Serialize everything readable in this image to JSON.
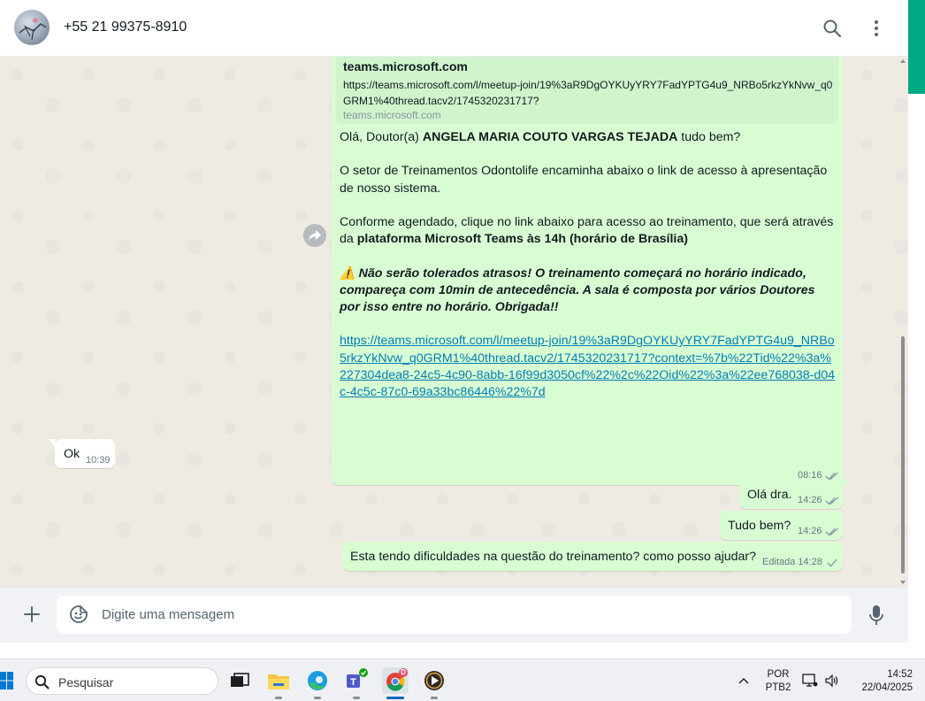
{
  "chat": {
    "contact_name": "+55 21 99375-8910"
  },
  "link_preview": {
    "title": "teams.microsoft.com",
    "url": "https://teams.microsoft.com/l/meetup-join/19%3aR9DgOYKUyYRY7FadYPTG4u9_NRBo5rkzYkNvw_q0GRM1%40thread.tacv2/1745320231717?",
    "domain": "teams.microsoft.com"
  },
  "long_message": {
    "greeting_prefix": "Olá, Doutor(a) ",
    "greeting_name": "ANGELA MARIA COUTO VARGAS TEJADA",
    "greeting_suffix": " tudo bem?",
    "paragraph2": "O setor de Treinamentos Odontolife encaminha abaixo o link de acesso à apresentação de nosso sistema.",
    "paragraph3_prefix": "Conforme agendado, clique no link abaixo para acesso ao treinamento, que será através da ",
    "paragraph3_bold": "plataforma Microsoft Teams às 14h (horário de Brasília)",
    "warning_emoji": "⚠️",
    "warning_text": " Não serão tolerados atrasos! O treinamento começará no horário indicado, compareça com 10min de antecedência. A sala é composta por vários Doutores por isso entre no horário. Obrigada!!",
    "link": "https://teams.microsoft.com/l/meetup-join/19%3aR9DgOYKUyYRY7FadYPTG4u9_NRBo5rkzYkNvw_q0GRM1%40thread.tacv2/1745320231717?context=%7b%22Tid%22%3a%227304dea8-24c5-4c90-8abb-16f99d3050cf%22%2c%22Oid%22%3a%22ee768038-d04c-4c5c-87c0-69a33bc86446%22%7d",
    "time": "08:16"
  },
  "messages": [
    {
      "direction": "in",
      "text": "Ok",
      "time": "10:39"
    },
    {
      "direction": "out",
      "text": "Olá dra.",
      "time": "14:26"
    },
    {
      "direction": "out",
      "text": "Tudo bem?",
      "time": "14:26"
    },
    {
      "direction": "out",
      "text": "Esta tendo dificuldades na questão do treinamento? como posso ajudar?",
      "edited_label": "Editada",
      "time": "14:28"
    }
  ],
  "composer": {
    "placeholder": "Digite uma mensagem"
  },
  "taskbar": {
    "search_label": "Pesquisar",
    "lang_line1": "POR",
    "lang_line2": "PTB2",
    "clock_time": "14:52",
    "clock_date": "22/04/2025",
    "chrome_badge": "D"
  },
  "colors": {
    "outgoing_bubble": "#d9fdd3",
    "incoming_bubble": "#ffffff",
    "link": "#027eb5",
    "read_ticks": "#8696a0",
    "accent": "#00a884"
  },
  "icons": {
    "header": [
      "search-icon",
      "menu-icon"
    ],
    "composer": [
      "plus-icon",
      "sticker-icon",
      "microphone-icon"
    ],
    "bubble": [
      "forward-icon",
      "double-check-icon",
      "single-check-icon",
      "warning-icon"
    ]
  }
}
